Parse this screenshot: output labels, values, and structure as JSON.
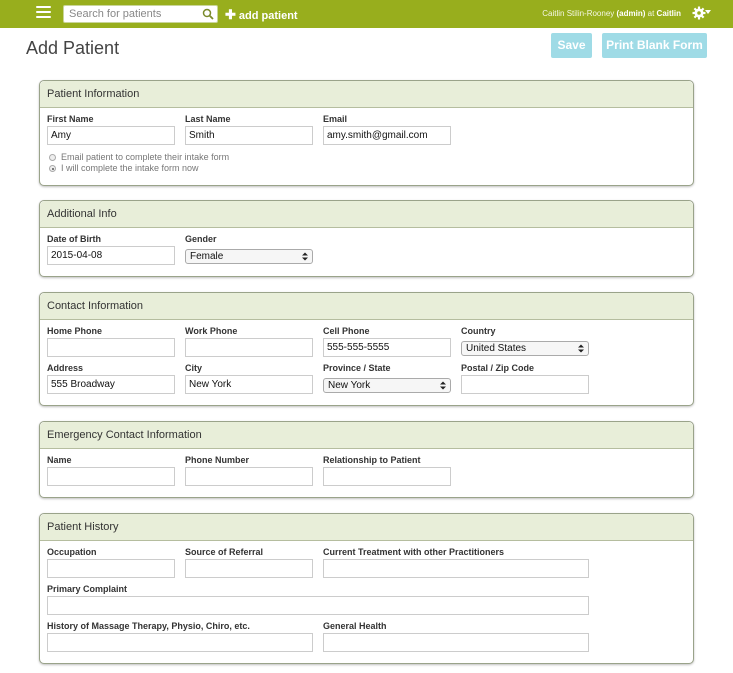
{
  "topbar": {
    "search_placeholder": "Search for patients",
    "add_patient_label": "add patient",
    "user_name": "Caitlin Stilin-Rooney",
    "user_role": "(admin)",
    "at_label": "at",
    "clinic_name": "Caitlin"
  },
  "header": {
    "title": "Add Patient",
    "save_label": "Save",
    "print_label": "Print Blank Form"
  },
  "patient_info": {
    "title": "Patient Information",
    "first_name_label": "First Name",
    "first_name_value": "Amy",
    "last_name_label": "Last Name",
    "last_name_value": "Smith",
    "email_label": "Email",
    "email_value": "amy.smith@gmail.com",
    "radio_email": "Email patient to complete their intake form",
    "radio_self": "I will complete the intake form now",
    "selected_option": "I will complete the intake form now"
  },
  "additional_info": {
    "title": "Additional Info",
    "dob_label": "Date of Birth",
    "dob_value": "2015-04-08",
    "gender_label": "Gender",
    "gender_value": "Female"
  },
  "contact_info": {
    "title": "Contact Information",
    "home_phone_label": "Home Phone",
    "home_phone_value": "",
    "work_phone_label": "Work Phone",
    "work_phone_value": "",
    "cell_phone_label": "Cell Phone",
    "cell_phone_value": "555-555-5555",
    "country_label": "Country",
    "country_value": "United States",
    "address_label": "Address",
    "address_value": "555 Broadway",
    "city_label": "City",
    "city_value": "New York",
    "province_label": "Province / State",
    "province_value": "New York",
    "postal_label": "Postal / Zip Code",
    "postal_value": ""
  },
  "emergency_contact": {
    "title": "Emergency Contact Information",
    "name_label": "Name",
    "phone_label": "Phone Number",
    "relationship_label": "Relationship to Patient"
  },
  "patient_history": {
    "title": "Patient History",
    "occupation_label": "Occupation",
    "referral_label": "Source of Referral",
    "current_treatment_label": "Current Treatment with other Practitioners",
    "primary_complaint_label": "Primary Complaint",
    "massage_history_label": "History of Massage Therapy, Physio, Chiro, etc.",
    "general_health_label": "General Health"
  },
  "colors": {
    "topbar": "#98ae1d",
    "panel_header": "#e8eed9",
    "button": "#9fdbe6"
  },
  "icons": [
    "hamburger-icon",
    "search-icon",
    "plus-icon",
    "gear-icon",
    "chevron-down-icon"
  ]
}
